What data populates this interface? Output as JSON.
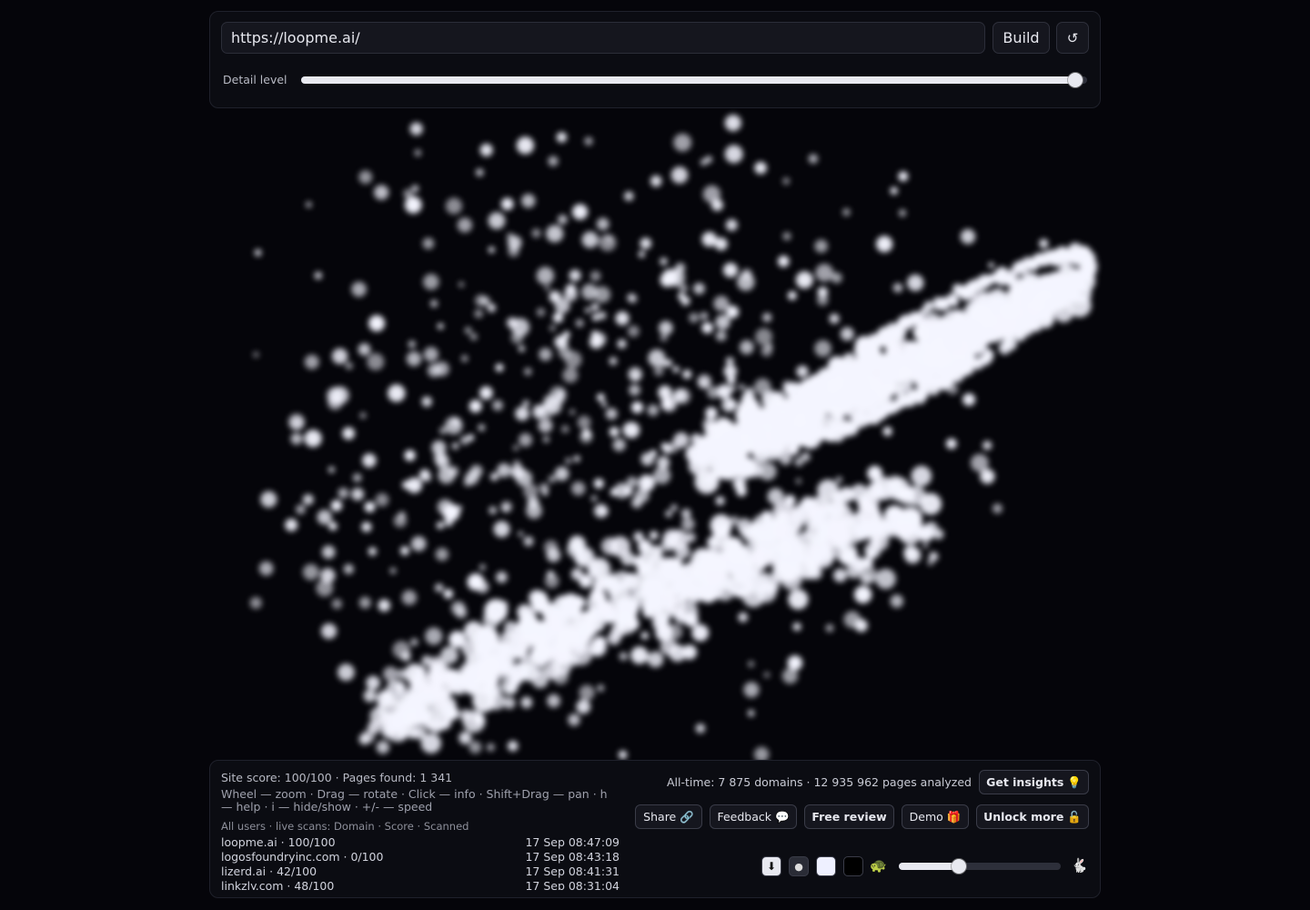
{
  "url": {
    "value": "https://loopme.ai/"
  },
  "buttons": {
    "build": "Build",
    "reset": "↺"
  },
  "detail": {
    "label": "Detail level",
    "level": 0.985
  },
  "status": {
    "summary": "Site score: 100/100 · Pages found: 1 341",
    "help": "Wheel — zoom · Drag — rotate · Click — info · Shift+Drag — pan · h — help · i — hide/show · +/- — speed"
  },
  "scans": {
    "header": "All users · live scans: Domain · Score · Scanned",
    "rows": [
      {
        "domain": "loopme.ai · 100/100",
        "time": "17 Sep 08:47:09"
      },
      {
        "domain": "logosfoundryinc.com · 0/100",
        "time": "17 Sep 08:43:18"
      },
      {
        "domain": "lizerd.ai · 42/100",
        "time": "17 Sep 08:41:31"
      },
      {
        "domain": "linkzly.com · 48/100",
        "time": "17 Sep 08:31:04"
      }
    ]
  },
  "alltime": "All-time: 7 875 domains · 12 935 962 pages analyzed",
  "actions": {
    "insights": "Get insights",
    "share": "Share",
    "feedback": "Feedback",
    "review": "Free review",
    "demo": "Demo",
    "unlock": "Unlock more"
  },
  "icons": {
    "insights": "💡",
    "share": "🔗",
    "feedback": "💬",
    "demo": "🎁",
    "unlock": "🔓",
    "download": "⬇",
    "dot": "●",
    "turtle": "🐢",
    "rabbit": "🐇"
  },
  "speed": {
    "level": 0.37
  },
  "colors": {
    "background": "#05050a",
    "particle": "#f4f5ff",
    "glow": "#9aa0ff"
  }
}
